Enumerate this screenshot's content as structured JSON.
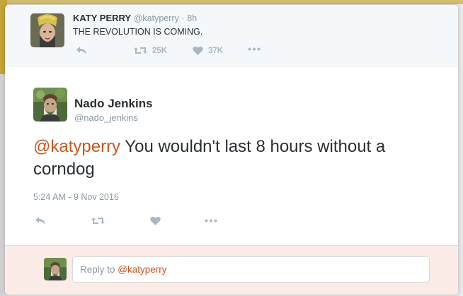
{
  "parent_tweet": {
    "name": "KATY PERRY",
    "handle": "@katyperry",
    "separator": "·",
    "time": "8h",
    "text": "THE REVOLUTION IS COMING.",
    "retweets": "25K",
    "likes": "37K"
  },
  "main_tweet": {
    "name": "Nado Jenkins",
    "handle": "@nado_jenkins",
    "mention": "@katyperry",
    "text": " You wouldn't last 8 hours without a corndog",
    "timestamp": "5:24 AM - 9 Nov 2016"
  },
  "reply": {
    "prefix": "Reply to ",
    "mention": "@katyperry"
  },
  "colors": {
    "accent": "#d0531d",
    "icon_gray": "#aab8c2",
    "text": "#292f33",
    "muted": "#8899a6"
  },
  "icons": {
    "reply": "reply-arrow-icon",
    "retweet": "retweet-icon",
    "like": "heart-icon",
    "more": "more-dots-icon"
  }
}
